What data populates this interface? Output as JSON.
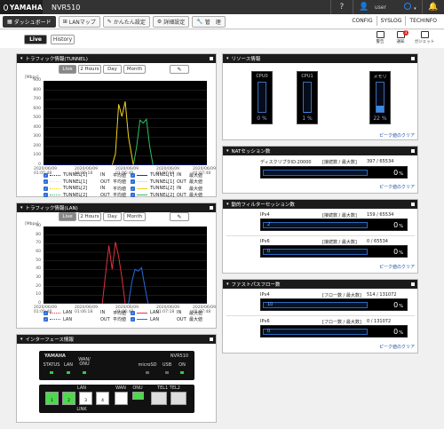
{
  "header": {
    "brand": "YAMAHA",
    "model": "NVR510",
    "help_icon": "question-icon",
    "user_label": "user",
    "bell_icon": "bell-icon"
  },
  "nav": {
    "dashboard": "ダッシュボード",
    "lanmap": "LANマップ",
    "easy_setup": "かんたん設定",
    "advanced": "詳細設定",
    "admin": "管　理",
    "right": [
      "CONFIG",
      "SYSLOG",
      "TECHINFO"
    ]
  },
  "tabs": {
    "live": "Live",
    "history": "History"
  },
  "tools": {
    "warning": "警告",
    "notice": "通知",
    "gadget": "ガジェット",
    "notice_count": "3"
  },
  "traffic_tunnel": {
    "title": "トラフィック情報(TUNNEL)",
    "range_buttons": [
      "Live",
      "2 Hours",
      "Day",
      "Month"
    ],
    "unit": "[Mbps]",
    "y_ticks": [
      "900",
      "800",
      "700",
      "600",
      "500",
      "400",
      "300",
      "200",
      "100",
      "0"
    ],
    "x_ticks": [
      {
        "date": "2020/06/09",
        "time": "01:05:48"
      },
      {
        "date": "2020/06/09",
        "time": "01:06:18"
      },
      {
        "date": "2020/06/09",
        "time": "01:06:48"
      },
      {
        "date": "2020/06/09",
        "time": "01:07:18"
      },
      {
        "date": "2020/06/09",
        "time": "01:07:48"
      }
    ],
    "legend": [
      {
        "name": "TUNNEL[1]",
        "dir": "IN",
        "kind": "平均値",
        "name2": "TUNNEL[1]",
        "dir2": "IN",
        "kind2": "最大値"
      },
      {
        "name": "TUNNEL[1]",
        "dir": "OUT",
        "kind": "平均値",
        "name2": "TUNNEL[1]",
        "dir2": "OUT",
        "kind2": "最大値"
      },
      {
        "name": "TUNNEL[2]",
        "dir": "IN",
        "kind": "平均値",
        "name2": "TUNNEL[2]",
        "dir2": "IN",
        "kind2": "最大値"
      },
      {
        "name": "TUNNEL[2]",
        "dir": "OUT",
        "kind": "平均値",
        "name2": "TUNNEL[2]",
        "dir2": "OUT",
        "kind2": "最大値"
      }
    ],
    "colors": [
      "#1a2fd0",
      "#e0e0e0",
      "#f2d21a",
      "#2ec060"
    ]
  },
  "traffic_lan": {
    "title": "トラフィック情報(LAN)",
    "range_buttons": [
      "Live",
      "2 Hours",
      "Day",
      "Month"
    ],
    "unit": "[Mbps]",
    "y_ticks": [
      "90",
      "80",
      "70",
      "60",
      "50",
      "40",
      "30",
      "20",
      "10",
      "0"
    ],
    "x_ticks": [
      {
        "date": "2020/06/09",
        "time": "01:05:48"
      },
      {
        "date": "2020/06/09",
        "time": "01:06:18"
      },
      {
        "date": "2020/06/09",
        "time": "01:06:48"
      },
      {
        "date": "2020/06/09",
        "time": "01:07:18"
      },
      {
        "date": "2020/06/09",
        "time": "01:07:48"
      }
    ],
    "legend": [
      {
        "name": "LAN",
        "dir": "IN",
        "kind": "平均値",
        "name2": "LAN",
        "dir2": "IN",
        "kind2": "最大値"
      },
      {
        "name": "LAN",
        "dir": "OUT",
        "kind": "平均値",
        "name2": "LAN",
        "dir2": "OUT",
        "kind2": "最大値"
      }
    ],
    "colors": [
      "#e03040",
      "#2a6ae0"
    ]
  },
  "interface": {
    "title": "インターフェース情報",
    "brand": "YAMAHA",
    "model": "NVR510",
    "status_labels": [
      "STATUS",
      "LAN",
      "WAN/\nONU",
      "microSD",
      "USB",
      "ON"
    ],
    "lan_label": "LAN",
    "link_label": "LINK",
    "ports": [
      "1",
      "2",
      "3",
      "4"
    ],
    "wan": "WAN",
    "onu": "ONU",
    "tel": "TEL1 TEL2"
  },
  "resource": {
    "title": "リソース情報",
    "cpu0": {
      "label": "CPU0",
      "value": "0",
      "unit": "%",
      "level": 0.0
    },
    "cpu1": {
      "label": "CPU1",
      "value": "1",
      "unit": "%",
      "level": 0.01
    },
    "memory": {
      "label": "メモリ",
      "value": "22",
      "unit": "%",
      "level": 0.22
    },
    "peak_clear": "ピーク値のクリア"
  },
  "nat": {
    "title": "NATセッション数",
    "descriptor": "ディスクリプタID:20000",
    "count_label": "[接続数 / 最大数]",
    "count": "397 / 65534",
    "percent": "0",
    "unit": "%",
    "peak_clear": "ピーク値のクリア"
  },
  "dynamic_filter": {
    "title": "動的フィルターセッション数",
    "ipv4_label": "IPv4",
    "ipv4_count_label": "[接続数 / 最大数]",
    "ipv4_count": "159 / 65534",
    "ipv4_percent": "0",
    "ipv4_peak": "2",
    "ipv6_label": "IPv6",
    "ipv6_count_label": "[接続数 / 最大数]",
    "ipv6_count": "0 / 65534",
    "ipv6_percent": "0",
    "ipv6_peak": "0",
    "unit": "%",
    "peak_clear": "ピーク値のクリア"
  },
  "fastpath": {
    "title": "ファストパスフロー数",
    "ipv4_label": "IPv4",
    "ipv4_count_label": "[フロー数 / 最大数]",
    "ipv4_count": "514 / 131072",
    "ipv4_percent": "0",
    "ipv4_peak": "10",
    "ipv6_label": "IPv6",
    "ipv6_count_label": "[フロー数 / 最大数]",
    "ipv6_count": "0 / 131072",
    "ipv6_percent": "0",
    "ipv6_peak": "0",
    "unit": "%",
    "peak_clear": "ピーク値のクリア"
  }
}
